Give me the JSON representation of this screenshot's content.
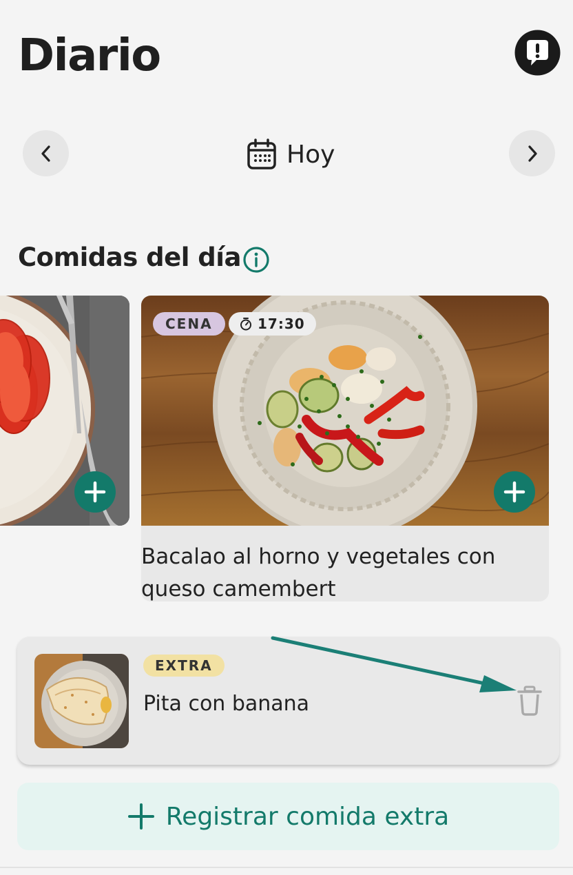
{
  "header": {
    "title": "Diario",
    "feedback_icon": "feedback-exclamation-icon"
  },
  "date_nav": {
    "prev_icon": "chevron-left-icon",
    "next_icon": "chevron-right-icon",
    "calendar_icon": "calendar-icon",
    "label": "Hoy"
  },
  "meals_section": {
    "title": "Comidas del día",
    "info_icon": "info-icon",
    "cards": [
      {
        "image": "tomato-slices-plate-photo",
        "add_icon": "plus-icon"
      },
      {
        "badge": "CENA",
        "time": "17:30",
        "time_icon": "timer-icon",
        "image": "cod-and-vegetables-plate-photo",
        "name": "Bacalao al horno y vegetales con queso camembert",
        "add_icon": "plus-icon"
      }
    ]
  },
  "extra_meal": {
    "badge": "EXTRA",
    "name": "Pita con banana",
    "image": "pita-plate-photo",
    "delete_icon": "trash-icon"
  },
  "register_extra": {
    "icon": "plus-icon",
    "label": "Registrar comida extra"
  },
  "colors": {
    "accent": "#137a6a",
    "background": "#f4f4f4",
    "cena_badge": "#d7c6e0",
    "extra_badge": "#f2e1a3",
    "register_bg": "#e5f4f1",
    "annotation_arrow": "#1b7f76"
  }
}
